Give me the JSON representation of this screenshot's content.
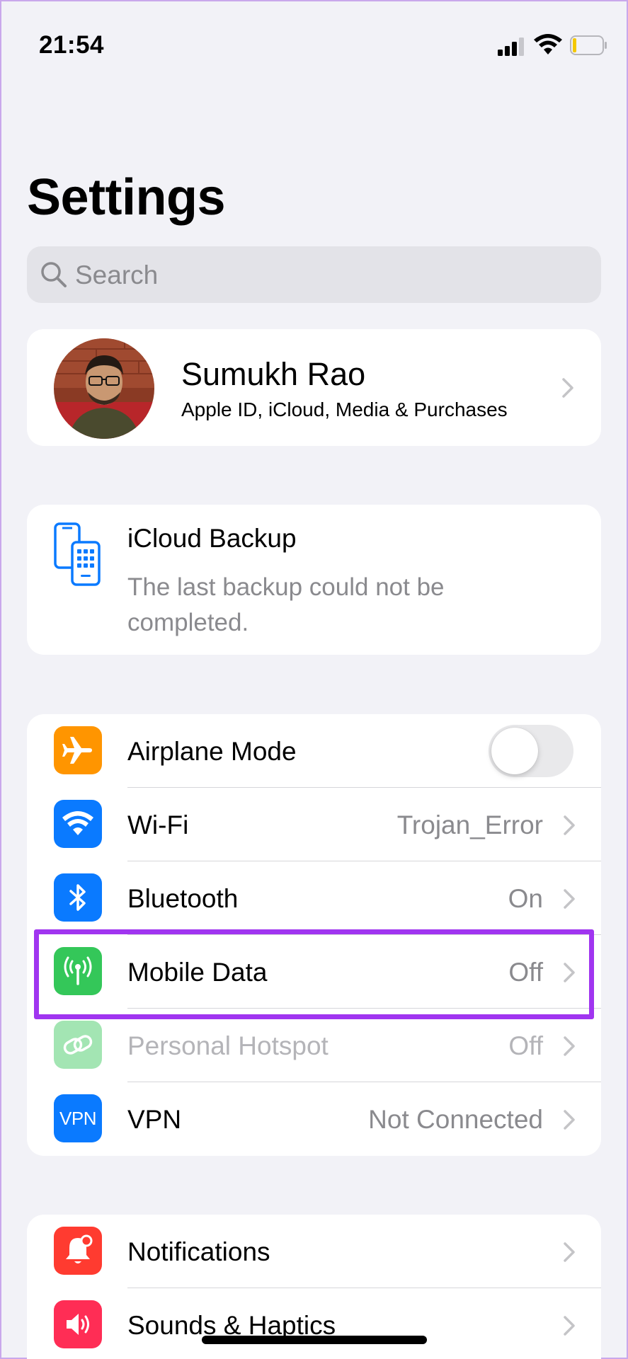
{
  "status_bar": {
    "time": "21:54",
    "signal_icon": "cellular-signal-icon",
    "wifi_icon": "wifi-icon",
    "battery_icon": "battery-low-icon"
  },
  "page": {
    "title": "Settings"
  },
  "search": {
    "placeholder": "Search",
    "icon": "search-icon"
  },
  "profile": {
    "name": "Sumukh Rao",
    "subtitle": "Apple ID, iCloud, Media & Purchases",
    "avatar_icon": "user-photo"
  },
  "icloud_backup": {
    "title": "iCloud Backup",
    "message": "The last backup could not be completed.",
    "icon": "devices-backup-icon"
  },
  "connectivity": [
    {
      "label": "Airplane Mode",
      "value": "",
      "icon": "airplane-icon",
      "color": "#ff9500",
      "toggle": false
    },
    {
      "label": "Wi-Fi",
      "value": "Trojan_Error",
      "icon": "wifi-icon",
      "color": "#0a7aff"
    },
    {
      "label": "Bluetooth",
      "value": "On",
      "icon": "bluetooth-icon",
      "color": "#0a7aff"
    },
    {
      "label": "Mobile Data",
      "value": "Off",
      "icon": "antenna-icon",
      "color": "#34c759",
      "highlighted": true
    },
    {
      "label": "Personal Hotspot",
      "value": "Off",
      "icon": "hotspot-link-icon",
      "color": "#34c759",
      "disabled": true
    },
    {
      "label": "VPN",
      "value": "Not Connected",
      "icon": "vpn-icon",
      "icon_text": "VPN",
      "color": "#0a7aff"
    }
  ],
  "notifications_group": [
    {
      "label": "Notifications",
      "icon": "bell-icon",
      "color": "#ff3b30"
    },
    {
      "label": "Sounds & Haptics",
      "icon": "speaker-icon",
      "color": "#ff2d55"
    }
  ],
  "colors": {
    "highlight_border": "#a035f0",
    "background": "#f2f2f7"
  }
}
